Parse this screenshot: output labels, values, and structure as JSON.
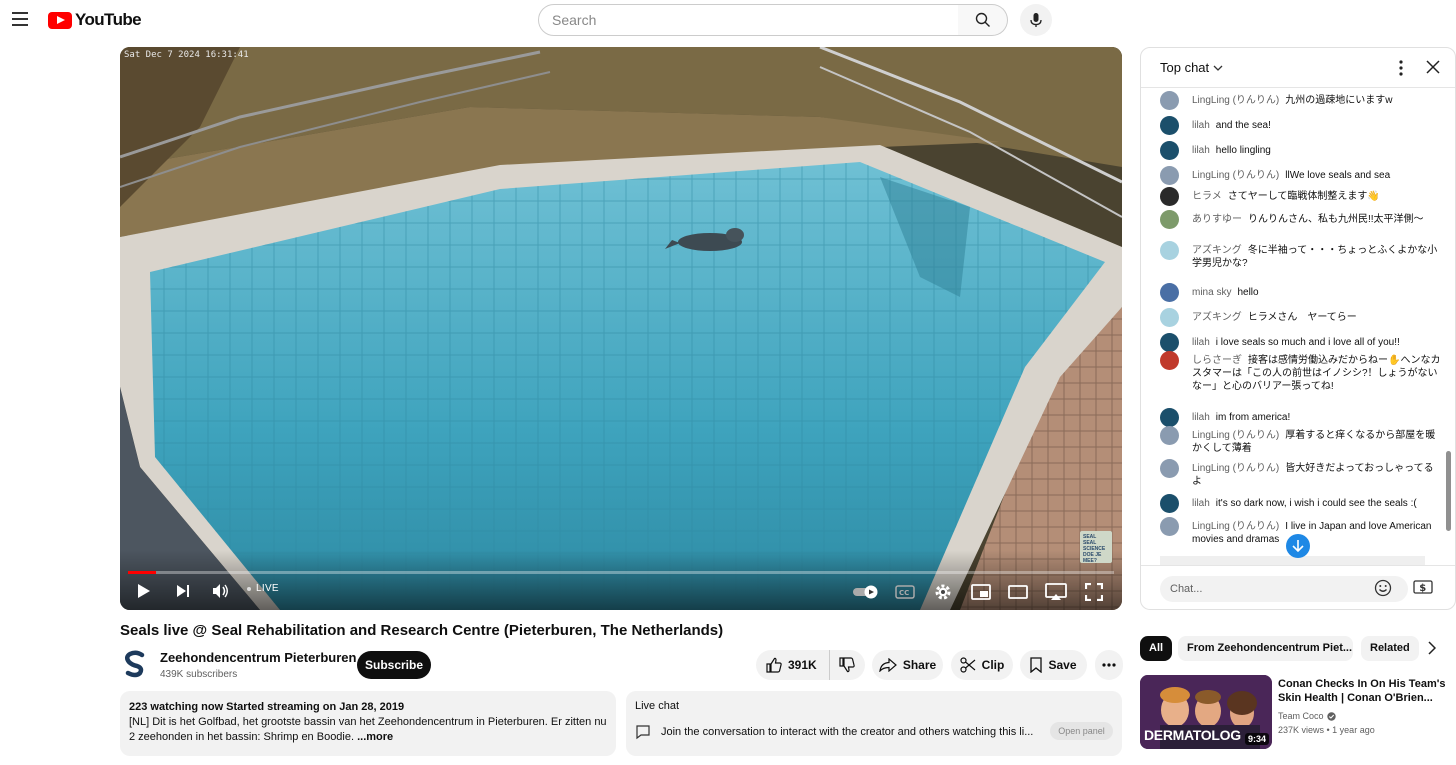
{
  "header": {
    "logo_text": "YouTube",
    "search_placeholder": "Search"
  },
  "player": {
    "timestamp_overlay": "Sat Dec  7 2024 16:31:41",
    "live_label": "LIVE",
    "watermark_text": "SEAL SEAL SCIENCE DOE JE MEE?"
  },
  "video": {
    "title": "Seals live @ Seal Rehabilitation and Research Centre (Pieterburen, The Netherlands)",
    "channel_name": "Zeehondencentrum Pieterburen",
    "subscribers": "439K subscribers",
    "subscribe_label": "Subscribe",
    "likes": "391K",
    "share_label": "Share",
    "clip_label": "Clip",
    "save_label": "Save"
  },
  "description": {
    "meta": "223 watching now  Started streaming on Jan 28, 2019",
    "body": "[NL] Dit is het Golfbad, het grootste bassin van het Zeehondencentrum in Pieterburen. Er zitten nu 2 zeehonden in het bassin: Shrimp en Boodie.",
    "more_label": "...more"
  },
  "live_chat_panel": {
    "title": "Live chat",
    "prompt": "Join the conversation to interact with the creator and others watching this li...",
    "open_panel_label": "Open panel"
  },
  "chat": {
    "header_label": "Top chat",
    "input_placeholder": "Chat...",
    "messages": [
      {
        "author": "LingLing (りんりん)",
        "text": "九州の過疎地にいますw",
        "avatar_color": "#8a9bb0"
      },
      {
        "author": "lilah",
        "text": "and the sea!",
        "avatar_color": "#1b4f6b"
      },
      {
        "author": "lilah",
        "text": "hello lingling",
        "avatar_color": "#1b4f6b"
      },
      {
        "author": "LingLing (りんりん)",
        "text": "llWe love seals and sea",
        "avatar_color": "#8a9bb0"
      },
      {
        "author": "ヒラメ",
        "text": "さてヤーして臨戦体制整えます👋",
        "avatar_color": "#2a2a2a"
      },
      {
        "author": "ありすゆー",
        "text": "りんりんさん、私も九州民!!太平洋側〜",
        "avatar_color": "#7d9a6a"
      },
      {
        "author": "アズキング",
        "text": "冬に半袖って・・・ちょっとふくよかな小学男児かな?",
        "avatar_color": "#a8d2e0"
      },
      {
        "author": "mina sky",
        "text": "hello",
        "avatar_color": "#4a6fa5"
      },
      {
        "author": "アズキング",
        "text": "ヒラメさん　ヤーてらー",
        "avatar_color": "#a8d2e0"
      },
      {
        "author": "lilah",
        "text": "i love seals so much and i love all of you!!",
        "avatar_color": "#1b4f6b"
      },
      {
        "author": "しらさーぎ",
        "text": "接客は感情労働込みだからねー✋へンなカスタマーは「この人の前世はイノシシ?！しょうがないなー」と心のバリアー張ってね!",
        "avatar_color": "#c0392b"
      },
      {
        "author": "lilah",
        "text": "im from america!",
        "avatar_color": "#1b4f6b"
      },
      {
        "author": "LingLing (りんりん)",
        "text": "厚着すると痒くなるから部屋を暖かくして薄着",
        "avatar_color": "#8a9bb0"
      },
      {
        "author": "LingLing (りんりん)",
        "text": "皆大好きだよっておっしゃってるよ",
        "avatar_color": "#8a9bb0"
      },
      {
        "author": "lilah",
        "text": "it's so dark now, i wish i could see the seals :(",
        "avatar_color": "#1b4f6b"
      },
      {
        "author": "LingLing (りんりん)",
        "text": "I live in Japan and love American movies and dramas",
        "avatar_color": "#8a9bb0"
      }
    ]
  },
  "chips": [
    "All",
    "From Zeehondencentrum Piet...",
    "Related"
  ],
  "recommendation": {
    "title": "Conan Checks In On His Team's Skin Health | Conan O'Brien...",
    "channel": "Team Coco",
    "meta": "237K views  •  1 year ago",
    "duration": "9:34",
    "thumb_label": "DERMATOLOG"
  }
}
